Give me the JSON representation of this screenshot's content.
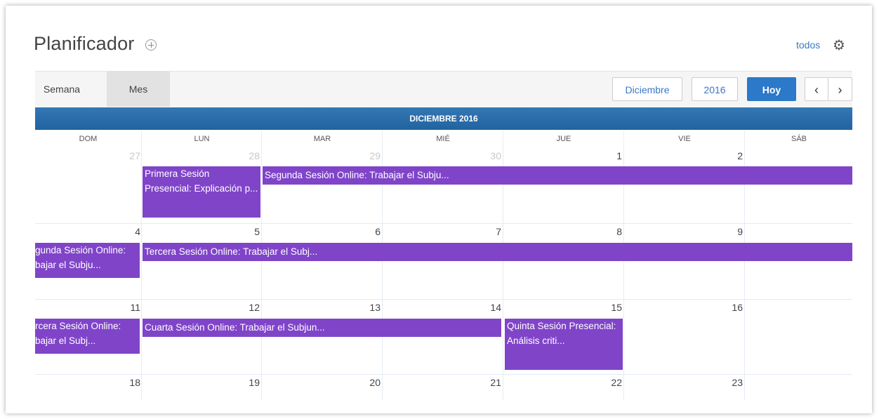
{
  "header": {
    "title": "Planificador",
    "todos_label": "todos"
  },
  "toolbar": {
    "tab_week": "Semana",
    "tab_month": "Mes",
    "month_button": "Diciembre",
    "year_button": "2016",
    "today_button": "Hoy",
    "prev_glyph": "‹",
    "next_glyph": "›"
  },
  "calendar": {
    "month_title": "DICIEMBRE 2016",
    "day_names": [
      "DOM",
      "LUN",
      "MAR",
      "MIÉ",
      "JUE",
      "VIE",
      "SÁB"
    ],
    "weeks": [
      [
        "27",
        "28",
        "29",
        "30",
        "1",
        "2",
        ""
      ],
      [
        "4",
        "5",
        "6",
        "7",
        "8",
        "9",
        ""
      ],
      [
        "11",
        "12",
        "13",
        "14",
        "15",
        "16",
        ""
      ],
      [
        "18",
        "19",
        "20",
        "21",
        "22",
        "23",
        ""
      ]
    ],
    "events": {
      "e1": "Primera Sesión Presencial: Explicación p...",
      "e2": "Segunda Sesión Online: Trabajar el Subju...",
      "e3": "gunda Sesión Online: bajar el Subju...",
      "e4": "Tercera Sesión Online: Trabajar el Subj...",
      "e5": "rcera Sesión Online: bajar el Subj...",
      "e6": "Cuarta Sesión Online: Trabajar el Subjun...",
      "e7": "Quinta Sesión Presencial: Análisis criti..."
    }
  },
  "colors": {
    "event": "#8044c9",
    "header_blue": "#2b6ead",
    "accent": "#2b79c8"
  }
}
